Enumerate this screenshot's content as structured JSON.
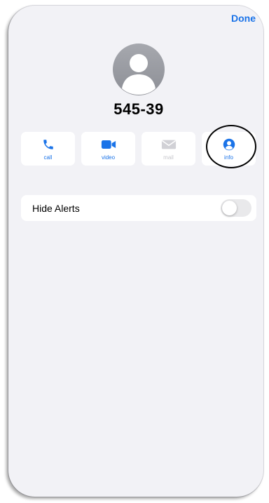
{
  "header": {
    "done_label": "Done"
  },
  "contact": {
    "name": "545-39"
  },
  "actions": [
    {
      "label": "call",
      "icon": "phone-icon",
      "enabled": true
    },
    {
      "label": "video",
      "icon": "video-camera-icon",
      "enabled": true
    },
    {
      "label": "mail",
      "icon": "mail-icon",
      "enabled": false
    },
    {
      "label": "info",
      "icon": "person-circle-icon",
      "enabled": true
    }
  ],
  "settings": {
    "hide_alerts": {
      "label": "Hide Alerts",
      "on": false
    }
  },
  "colors": {
    "accent": "#1a73e8",
    "disabled": "#c7c7cc",
    "background": "#f2f2f6"
  }
}
